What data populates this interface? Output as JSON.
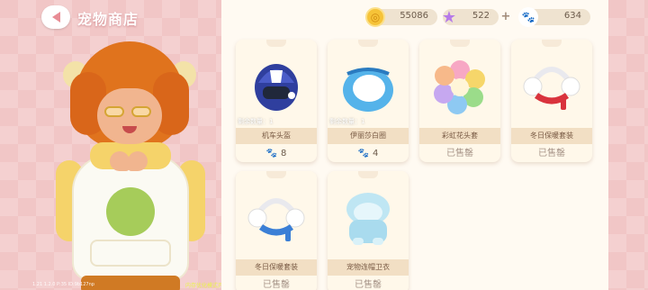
{
  "header": {
    "title": "宠物商店",
    "back_icon": "back-arrow-icon"
  },
  "currency": [
    {
      "icon": "coin-icon",
      "value": "55086"
    },
    {
      "icon": "star-icon",
      "value": "522"
    },
    {
      "icon": "paw-icon",
      "value": "634"
    }
  ],
  "plus_label": "+",
  "items": [
    {
      "name": "机车头盔",
      "price": "8",
      "status": "",
      "remaining": "剩余数量：1"
    },
    {
      "name": "伊丽莎白圈",
      "price": "4",
      "status": "",
      "remaining": "剩余数量：1"
    },
    {
      "name": "彩虹花头套",
      "price": "",
      "status": "已售罄",
      "remaining": ""
    },
    {
      "name": "冬日保暖套装",
      "price": "",
      "status": "已售罄",
      "remaining": ""
    },
    {
      "name": "冬日保暖套装",
      "price": "",
      "status": "已售罄",
      "remaining": ""
    },
    {
      "name": "宠物连帽卫衣",
      "price": "",
      "status": "已售罄",
      "remaining": ""
    }
  ],
  "debug": {
    "left": "1.21   1.2.0  P:35  ID:9b127np",
    "right": "内存优化模式开启中"
  },
  "colors": {
    "accent_pink": "#f1c6c6",
    "card_bg": "#fff8ea",
    "strip": "#f2dfc4"
  }
}
